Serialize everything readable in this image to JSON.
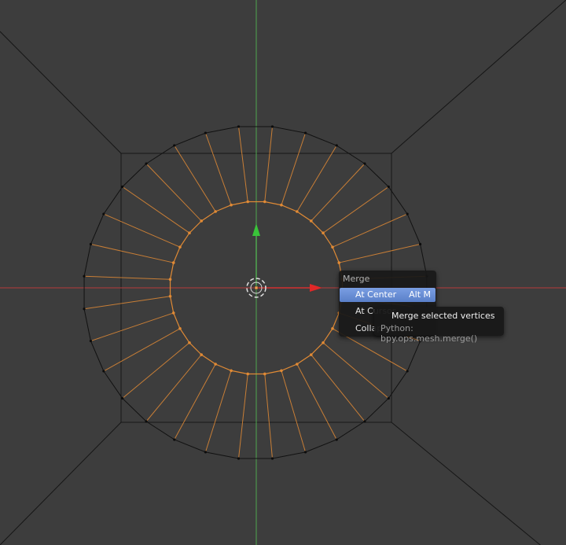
{
  "viewport": {
    "background": "#3d3d3d",
    "colors": {
      "x_axis": "#b83c3c",
      "y_axis": "#4ea84e",
      "selected_edge": "#e08a35",
      "wire": "#111111",
      "menu_highlight": "#6a8fd6"
    },
    "mesh": {
      "segments": 32,
      "selection": "inner-ring vertices and radial edges selected"
    },
    "widgets": [
      "3d-cursor-icon",
      "y-axis-arrow-icon",
      "x-axis-arrow-icon"
    ]
  },
  "menu": {
    "title": "Merge",
    "items": [
      {
        "label": "At Center",
        "shortcut": "Alt M",
        "active": true
      },
      {
        "label": "At Cursor",
        "shortcut": "",
        "active": false
      },
      {
        "label": "Collapse",
        "shortcut": "",
        "active": false
      }
    ]
  },
  "tooltip": {
    "title": "Merge selected vertices",
    "python": "Python: bpy.ops.mesh.merge()"
  }
}
